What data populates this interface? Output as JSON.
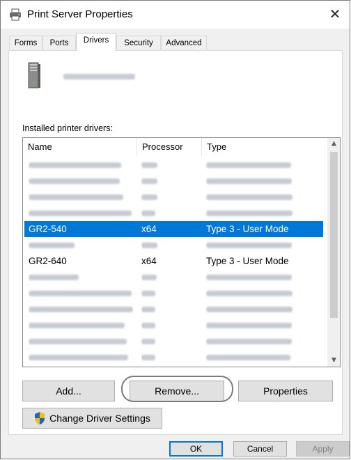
{
  "window": {
    "title": "Print Server Properties",
    "close_glyph": "✕"
  },
  "tabs": [
    {
      "label": "Forms",
      "active": false
    },
    {
      "label": "Ports",
      "active": false
    },
    {
      "label": "Drivers",
      "active": true
    },
    {
      "label": "Security",
      "active": false
    },
    {
      "label": "Advanced",
      "active": false
    }
  ],
  "drivers_tab": {
    "server_name_redacted": true,
    "installed_label": "Installed printer drivers:",
    "columns": [
      "Name",
      "Processor",
      "Type"
    ],
    "rows": [
      {
        "name": "",
        "processor": "",
        "type": "",
        "redacted": true,
        "selected": false
      },
      {
        "name": "",
        "processor": "",
        "type": "",
        "redacted": true,
        "selected": false
      },
      {
        "name": "",
        "processor": "",
        "type": "",
        "redacted": true,
        "selected": false
      },
      {
        "name": "",
        "processor": "",
        "type": "",
        "redacted": true,
        "selected": false
      },
      {
        "name": "GR2-540",
        "processor": "x64",
        "type": "Type 3 - User Mode",
        "redacted": false,
        "selected": true
      },
      {
        "name": "",
        "processor": "",
        "type": "",
        "redacted": true,
        "selected": false
      },
      {
        "name": "GR2-640",
        "processor": "x64",
        "type": "Type 3 - User Mode",
        "redacted": false,
        "selected": false
      },
      {
        "name": "",
        "processor": "",
        "type": "",
        "redacted": true,
        "selected": false
      },
      {
        "name": "",
        "processor": "",
        "type": "",
        "redacted": true,
        "selected": false
      },
      {
        "name": "",
        "processor": "",
        "type": "",
        "redacted": true,
        "selected": false
      },
      {
        "name": "",
        "processor": "",
        "type": "",
        "redacted": true,
        "selected": false
      },
      {
        "name": "",
        "processor": "",
        "type": "",
        "redacted": true,
        "selected": false
      },
      {
        "name": "",
        "processor": "",
        "type": "",
        "redacted": true,
        "selected": false
      },
      {
        "name": "",
        "processor": "",
        "type": "",
        "redacted": true,
        "selected": false
      }
    ],
    "buttons": {
      "add": "Add...",
      "remove": "Remove...",
      "properties": "Properties",
      "change_settings": "Change Driver Settings"
    }
  },
  "dialog_buttons": {
    "ok": "OK",
    "cancel": "Cancel",
    "apply": "Apply"
  },
  "colors": {
    "selection": "#0078d7",
    "highlight_ring": "#7a7a7a"
  },
  "icons": {
    "title": "printer-icon",
    "server": "server-tower-icon",
    "change_settings": "uac-shield-icon"
  }
}
